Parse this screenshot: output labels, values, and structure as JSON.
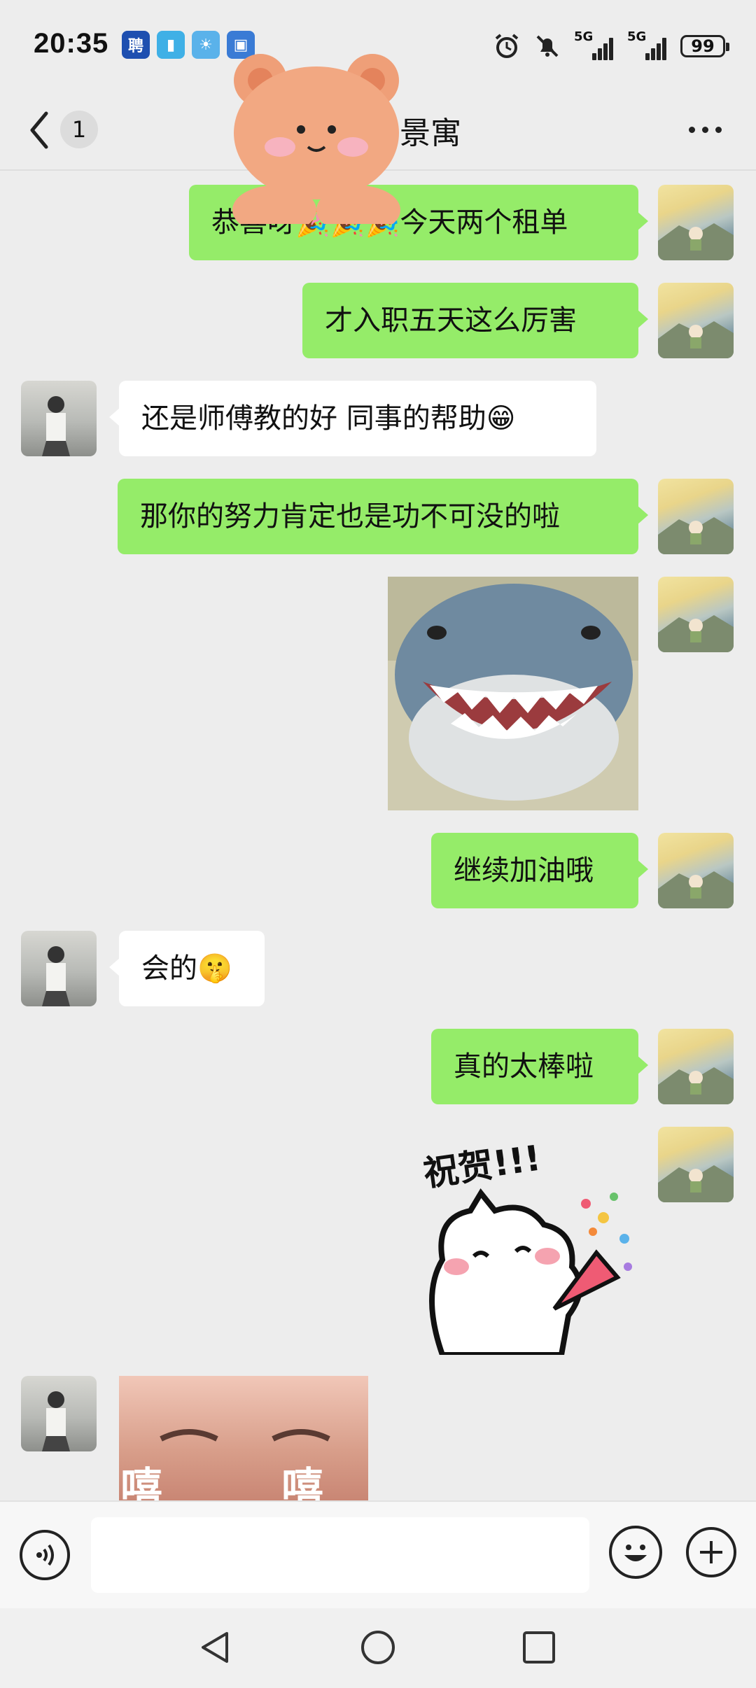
{
  "status_bar": {
    "time": "20:35",
    "app_icons": [
      "ping-app-icon",
      "book-app-icon",
      "weather-app-icon",
      "wallet-app-icon"
    ],
    "network_1": "5G",
    "network_2": "5G",
    "battery": "99"
  },
  "header": {
    "unread_count": "1",
    "title_visible": "景寓"
  },
  "messages": [
    {
      "from": "me",
      "type": "text",
      "text": "恭喜呀🎉🎉🎉今天两个租单"
    },
    {
      "from": "me",
      "type": "text",
      "text": "才入职五天这么厉害"
    },
    {
      "from": "them",
      "type": "text",
      "text": "还是师傅教的好 同事的帮助😁"
    },
    {
      "from": "me",
      "type": "text",
      "text": "那你的努力肯定也是功不可没的啦"
    },
    {
      "from": "me",
      "type": "image",
      "text": "smiling-shark-sticker"
    },
    {
      "from": "me",
      "type": "text",
      "text": "继续加油哦"
    },
    {
      "from": "them",
      "type": "text",
      "text": "会的🤫"
    },
    {
      "from": "me",
      "type": "text",
      "text": "真的太棒啦"
    },
    {
      "from": "me",
      "type": "sticker",
      "caption": "祝贺!!!"
    },
    {
      "from": "them",
      "type": "sticker",
      "caption_left": "嘻",
      "caption_right": "嘻"
    }
  ],
  "colors": {
    "background": "#ededed",
    "my_bubble": "#95ec69",
    "their_bubble": "#ffffff"
  }
}
